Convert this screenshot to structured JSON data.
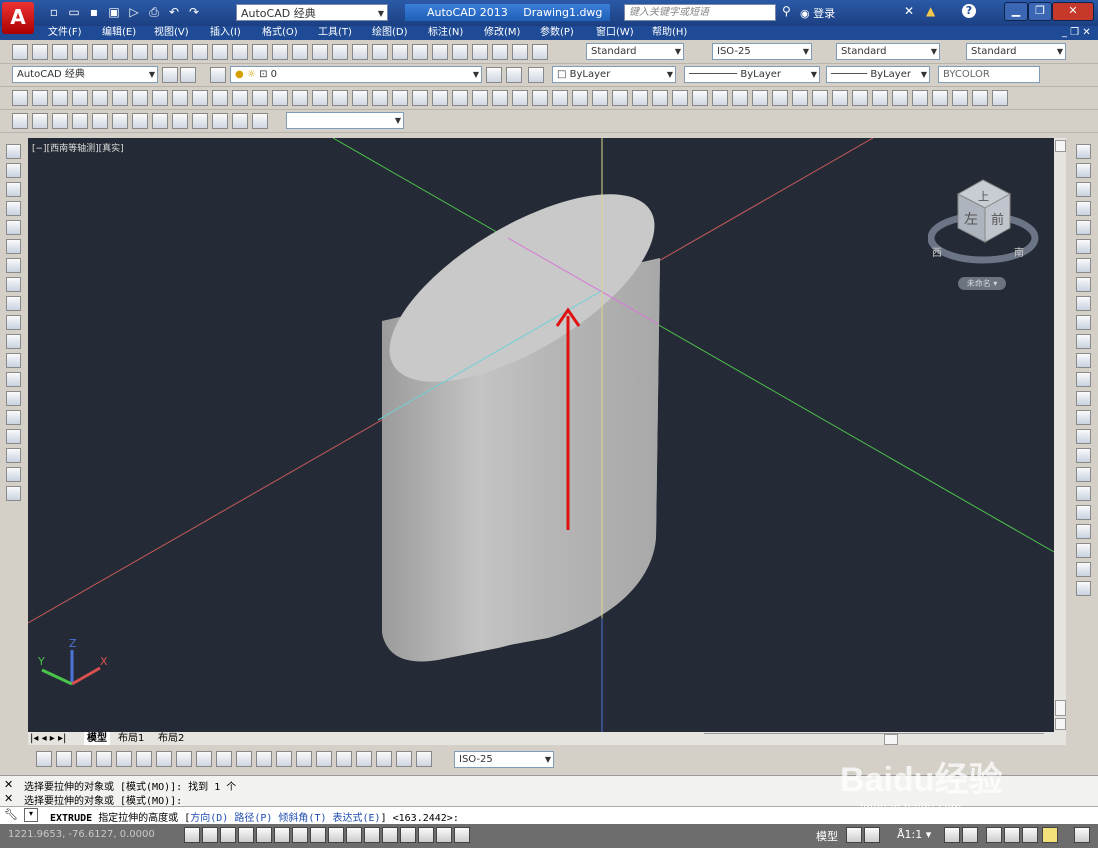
{
  "window": {
    "app_logo": "A",
    "workspace": "AutoCAD 经典",
    "app_title": "AutoCAD 2013",
    "document_title": "Drawing1.dwg",
    "search_placeholder": "键入关键字或短语",
    "login_label": "登录",
    "help_label": "?"
  },
  "menu": [
    "文件(F)",
    "编辑(E)",
    "视图(V)",
    "插入(I)",
    "格式(O)",
    "工具(T)",
    "绘图(D)",
    "标注(N)",
    "修改(M)",
    "参数(P)",
    "窗口(W)",
    "帮助(H)"
  ],
  "styles": {
    "text_style": "Standard",
    "dim_style": "ISO-25",
    "table_style": "Standard",
    "multileader_style": "Standard"
  },
  "layers": {
    "workspace": "AutoCAD 经典",
    "current_layer": "0",
    "color": "ByLayer",
    "linetype": "ByLayer",
    "lineweight": "ByLayer",
    "plot_style": "BYCOLOR"
  },
  "viewport": {
    "label": "[−][西南等轴测][真实]",
    "viewcube_faces": {
      "top": "上",
      "front": "前",
      "left": "左"
    },
    "compass": {
      "west": "西",
      "south": "南"
    },
    "ucs_menu": "未命名",
    "ucs_labels": {
      "x": "X",
      "y": "Y",
      "z": "Z"
    }
  },
  "layout_tabs": [
    "模型",
    "布局1",
    "布局2"
  ],
  "dim_toolbar": {
    "dim_style": "ISO-25"
  },
  "command": {
    "history": [
      "选择要拉伸的对象或 [模式(MO)]: 找到 1 个",
      "选择要拉伸的对象或 [模式(MO)]:"
    ],
    "prompt_command": "EXTRUDE",
    "prompt_text": "指定拉伸的高度或",
    "options": [
      "方向(D)",
      "路径(P)",
      "倾斜角(T)",
      "表达式(E)"
    ],
    "default_value": "<163.2442>:"
  },
  "status": {
    "coordinates": "1221.9653, -76.6127, 0.0000",
    "space": "模型",
    "annotation_scale": "1:1"
  },
  "watermark": {
    "brand": "Baidu经验",
    "url": "jingyan.baidu.com"
  },
  "colors": {
    "viewport_bg": "#252b36",
    "axis_red": "#d85050",
    "axis_green": "#49c449",
    "axis_blue": "#4d73d8",
    "arrow": "#e01010",
    "title_bar": "#1f4b96"
  }
}
